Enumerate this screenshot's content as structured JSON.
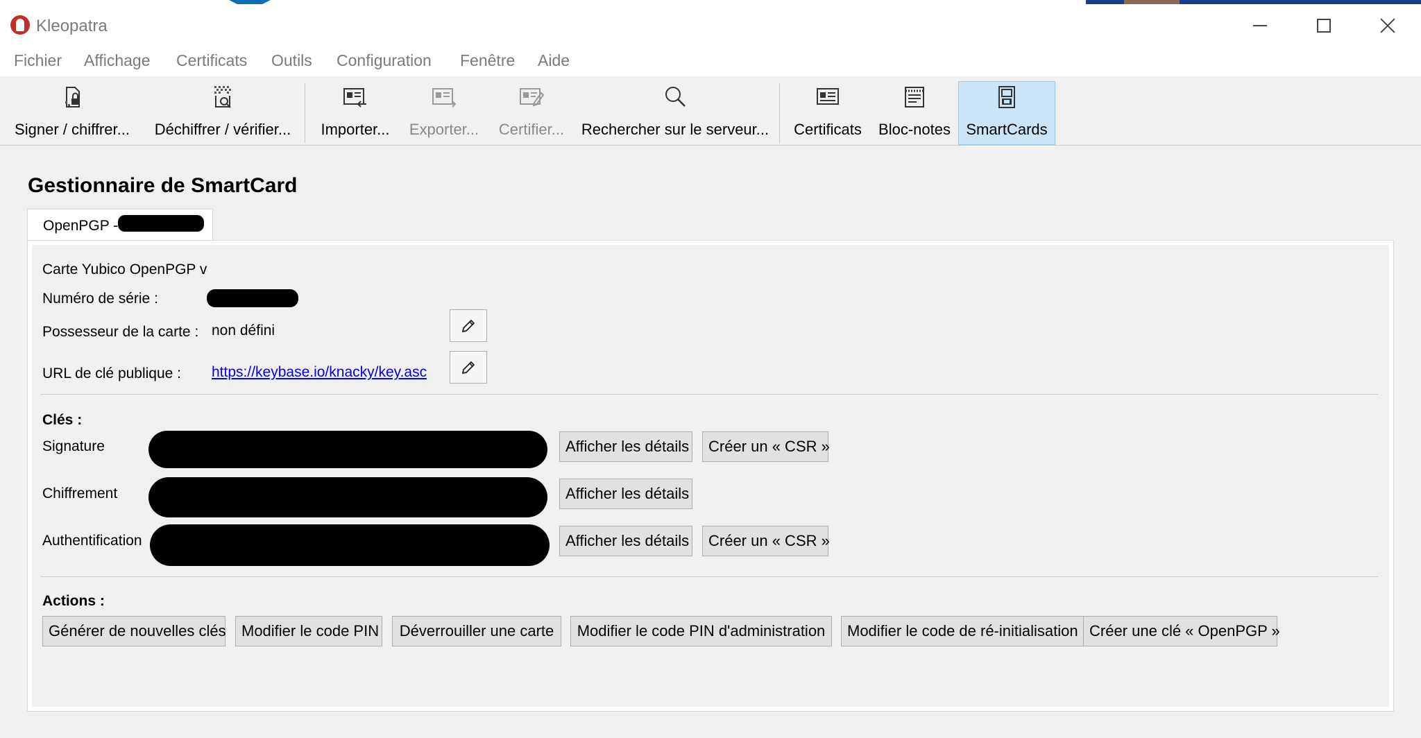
{
  "window": {
    "title": "Kleopatra",
    "controls": {
      "minimize": "minimize-icon",
      "maximize": "maximize-icon",
      "close": "close-icon"
    }
  },
  "menu": [
    "Fichier",
    "Affichage",
    "Certificats",
    "Outils",
    "Configuration",
    "Fenêtre",
    "Aide"
  ],
  "toolbar": {
    "sign_encrypt": "Signer / chiffrer...",
    "decrypt_verify": "Déchiffrer / vérifier...",
    "import": "Importer...",
    "export": "Exporter...",
    "certify": "Certifier...",
    "search_server": "Rechercher sur le serveur...",
    "certificates": "Certificats",
    "notepad": "Bloc-notes",
    "smartcards": "SmartCards",
    "disabled": [
      "Exporter...",
      "Certifier..."
    ],
    "active": "SmartCards"
  },
  "page": {
    "title": "Gestionnaire de SmartCard",
    "tab_label": "OpenPGP -"
  },
  "card": {
    "type_line": "Carte Yubico OpenPGP v",
    "serial_label": "Numéro de série :",
    "owner_label": "Possesseur de la carte :",
    "owner_value": "non défini",
    "pubkey_url_label": "URL de clé publique :",
    "pubkey_url_value": "https://keybase.io/knacky/key.asc"
  },
  "keys": {
    "heading": "Clés :",
    "signature_label": "Signature",
    "encryption_label": "Chiffrement",
    "auth_label": "Authentification",
    "show_details": "Afficher les détails",
    "create_csr": "Créer un « CSR »"
  },
  "actions": {
    "heading": "Actions :",
    "generate_keys": "Générer de nouvelles clés",
    "change_pin": "Modifier le code PIN",
    "unblock_card": "Déverrouiller une carte",
    "change_admin_pin": "Modifier le code PIN d'administration",
    "change_reset_code": "Modifier le code de ré-initialisation",
    "create_openpgp_key": "Créer une clé « OpenPGP »"
  },
  "colors": {
    "active_tool_bg": "#cce4f7",
    "link": "#0000ee",
    "window_bg": "#f0f0f0"
  }
}
